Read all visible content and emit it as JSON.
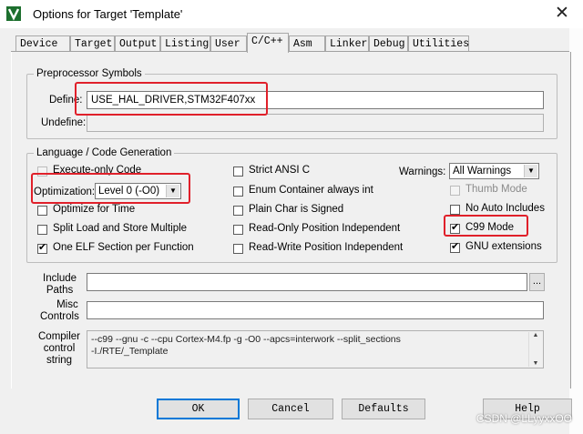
{
  "window": {
    "title": "Options for Target 'Template'",
    "close_glyph": "✕"
  },
  "tabs": [
    "Device",
    "Target",
    "Output",
    "Listing",
    "User",
    "C/C++",
    "Asm",
    "Linker",
    "Debug",
    "Utilities"
  ],
  "active_tab": "C/C++",
  "preprocessor": {
    "group_label": "Preprocessor Symbols",
    "define_label": "Define:",
    "define_value": "USE_HAL_DRIVER,STM32F407xx",
    "undefine_label": "Undefine:",
    "undefine_value": ""
  },
  "codegen": {
    "group_label": "Language / Code Generation",
    "execute_only": {
      "label": "Execute-only Code",
      "checked": false,
      "enabled": true
    },
    "optimization_label": "Optimization:",
    "optimization_value": "Level 0 (-O0)",
    "optimize_time": {
      "label": "Optimize for Time",
      "checked": false
    },
    "split_load": {
      "label": "Split Load and Store Multiple",
      "checked": false
    },
    "one_elf": {
      "label": "One ELF Section per Function",
      "checked": true
    },
    "strict_ansi": {
      "label": "Strict ANSI C",
      "checked": false
    },
    "enum_container": {
      "label": "Enum Container always int",
      "checked": false
    },
    "plain_char": {
      "label": "Plain Char is Signed",
      "checked": false
    },
    "ro_pi": {
      "label": "Read-Only Position Independent",
      "checked": false
    },
    "rw_pi": {
      "label": "Read-Write Position Independent",
      "checked": false
    },
    "warnings_label": "Warnings:",
    "warnings_value": "All Warnings",
    "thumb_mode": {
      "label": "Thumb Mode",
      "checked": false,
      "enabled": false
    },
    "no_auto_includes": {
      "label": "No Auto Includes",
      "checked": false
    },
    "c99_mode": {
      "label": "C99 Mode",
      "checked": true
    },
    "gnu_extensions": {
      "label": "GNU extensions",
      "checked": true
    }
  },
  "include_paths": {
    "label_line1": "Include",
    "label_line2": "Paths",
    "value": "",
    "browse_label": "..."
  },
  "misc_controls": {
    "label_line1": "Misc",
    "label_line2": "Controls",
    "value": ""
  },
  "compiler_control": {
    "label_line1": "Compiler",
    "label_line2": "control",
    "label_line3": "string",
    "line1": "--c99 --gnu -c --cpu Cortex-M4.fp -g -O0 --apcs=interwork --split_sections",
    "line2": "-I./RTE/_Template"
  },
  "buttons": {
    "ok": "OK",
    "cancel": "Cancel",
    "defaults": "Defaults",
    "help": "Help"
  },
  "watermark": "CSDN @LLyyxxOO",
  "colors": {
    "highlight_box": "#e0202a",
    "focus_blue": "#0078d7"
  }
}
